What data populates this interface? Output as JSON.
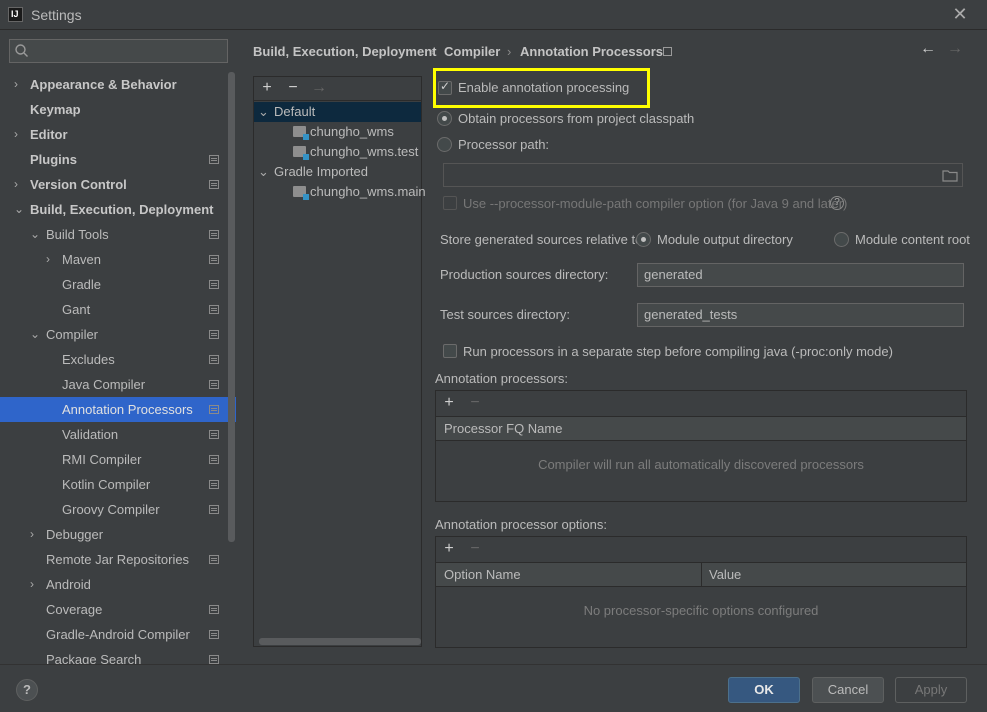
{
  "window": {
    "title": "Settings",
    "logo_text": "IJ",
    "close_glyph": "✕"
  },
  "search": {
    "placeholder": ""
  },
  "sidebar": {
    "items": [
      {
        "label": "Appearance & Behavior",
        "bold": true,
        "arrow": "›",
        "page_icon": false
      },
      {
        "label": "Keymap",
        "bold": true,
        "arrow": "",
        "page_icon": false
      },
      {
        "label": "Editor",
        "bold": true,
        "arrow": "›",
        "page_icon": false
      },
      {
        "label": "Plugins",
        "bold": true,
        "arrow": "",
        "page_icon": true
      },
      {
        "label": "Version Control",
        "bold": true,
        "arrow": "›",
        "page_icon": true
      },
      {
        "label": "Build, Execution, Deployment",
        "bold": true,
        "arrow": "⌄",
        "page_icon": false
      },
      {
        "label": "Build Tools",
        "bold": false,
        "arrow": "⌄",
        "page_icon": true
      },
      {
        "label": "Maven",
        "bold": false,
        "arrow": "›",
        "page_icon": true
      },
      {
        "label": "Gradle",
        "bold": false,
        "arrow": "",
        "page_icon": true
      },
      {
        "label": "Gant",
        "bold": false,
        "arrow": "",
        "page_icon": true
      },
      {
        "label": "Compiler",
        "bold": false,
        "arrow": "⌄",
        "page_icon": true
      },
      {
        "label": "Excludes",
        "bold": false,
        "arrow": "",
        "page_icon": true
      },
      {
        "label": "Java Compiler",
        "bold": false,
        "arrow": "",
        "page_icon": true
      },
      {
        "label": "Annotation Processors",
        "bold": false,
        "arrow": "",
        "page_icon": true,
        "selected": true
      },
      {
        "label": "Validation",
        "bold": false,
        "arrow": "",
        "page_icon": true
      },
      {
        "label": "RMI Compiler",
        "bold": false,
        "arrow": "",
        "page_icon": true
      },
      {
        "label": "Kotlin Compiler",
        "bold": false,
        "arrow": "",
        "page_icon": true
      },
      {
        "label": "Groovy Compiler",
        "bold": false,
        "arrow": "",
        "page_icon": true
      },
      {
        "label": "Debugger",
        "bold": false,
        "arrow": "›",
        "page_icon": false
      },
      {
        "label": "Remote Jar Repositories",
        "bold": false,
        "arrow": "",
        "page_icon": true
      },
      {
        "label": "Android",
        "bold": false,
        "arrow": "›",
        "page_icon": false
      },
      {
        "label": "Coverage",
        "bold": false,
        "arrow": "",
        "page_icon": true
      },
      {
        "label": "Gradle-Android Compiler",
        "bold": false,
        "arrow": "",
        "page_icon": true
      },
      {
        "label": "Package Search",
        "bold": false,
        "arrow": "",
        "page_icon": true
      }
    ]
  },
  "breadcrumb": {
    "parts": [
      "Build, Execution, Deployment",
      "Compiler",
      "Annotation Processors"
    ],
    "separator": "›"
  },
  "nav": {
    "back": "←",
    "forward": "→"
  },
  "modules": {
    "toolbar": {
      "add": "+",
      "remove": "−",
      "move": "→"
    },
    "items": [
      {
        "label": "Default",
        "arrow": "⌄",
        "selected": true,
        "folder": false
      },
      {
        "label": "chungho_wms",
        "arrow": "",
        "folder": true
      },
      {
        "label": "chungho_wms.test",
        "arrow": "",
        "folder": true
      },
      {
        "label": "Gradle Imported",
        "arrow": "⌄",
        "folder": false
      },
      {
        "label": "chungho_wms.main",
        "arrow": "",
        "folder": true
      }
    ]
  },
  "settings": {
    "enable_annotation_processing": {
      "label": "Enable annotation processing",
      "checked": true
    },
    "obtain_from_classpath": {
      "label": "Obtain processors from project classpath",
      "checked": true
    },
    "processor_path": {
      "label": "Processor path:",
      "checked": false,
      "value": ""
    },
    "use_module_path": {
      "label": "Use --processor-module-path compiler option (for Java 9 and later)",
      "checked": false,
      "help": "?"
    },
    "store_relative_label": "Store generated sources relative to:",
    "module_output_dir": {
      "label": "Module output directory",
      "checked": true
    },
    "module_content_root": {
      "label": "Module content root",
      "checked": false
    },
    "production_dir": {
      "label": "Production sources directory:",
      "value": "generated"
    },
    "test_dir": {
      "label": "Test sources directory:",
      "value": "generated_tests"
    },
    "run_separate": {
      "label": "Run processors in a separate step before compiling java (-proc:only mode)",
      "checked": false
    }
  },
  "processors_table": {
    "section_label": "Annotation processors:",
    "add": "+",
    "remove": "−",
    "columns": [
      "Processor FQ Name"
    ],
    "empty_text": "Compiler will run all automatically discovered processors"
  },
  "options_table": {
    "section_label": "Annotation processor options:",
    "add": "+",
    "remove": "−",
    "columns": [
      "Option Name",
      "Value"
    ],
    "empty_text": "No processor-specific options configured"
  },
  "buttons": {
    "help": "?",
    "ok": "OK",
    "cancel": "Cancel",
    "apply": "Apply"
  }
}
